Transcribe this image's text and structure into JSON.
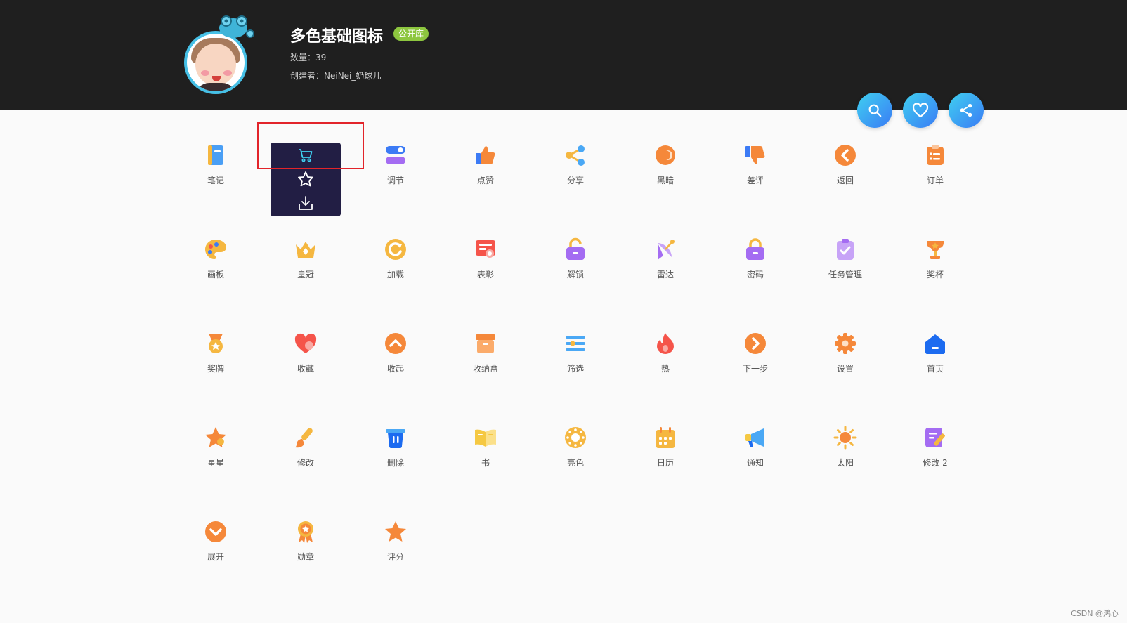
{
  "header": {
    "title": "多色基础图标",
    "badge": "公开库",
    "count_text": "数量：39",
    "creator_text": "创建者：NeiNei_奶球儿",
    "actions": [
      "search-icon",
      "heart-icon",
      "share-icon"
    ]
  },
  "hover_card": {
    "actions": [
      "cart-icon",
      "star-outline-icon",
      "download-icon"
    ]
  },
  "icons": [
    {
      "label": "笔记",
      "icon": "notebook-icon"
    },
    {
      "label": "",
      "icon": "cart-icon"
    },
    {
      "label": "调节",
      "icon": "toggle-icon"
    },
    {
      "label": "点赞",
      "icon": "thumbs-up-icon"
    },
    {
      "label": "分享",
      "icon": "share-nodes-icon"
    },
    {
      "label": "黑暗",
      "icon": "moon-icon"
    },
    {
      "label": "差评",
      "icon": "thumbs-down-icon"
    },
    {
      "label": "返回",
      "icon": "back-icon"
    },
    {
      "label": "订单",
      "icon": "order-icon"
    },
    {
      "label": "画板",
      "icon": "palette-icon"
    },
    {
      "label": "皇冠",
      "icon": "crown-icon"
    },
    {
      "label": "加载",
      "icon": "loading-icon"
    },
    {
      "label": "表彰",
      "icon": "certificate-icon"
    },
    {
      "label": "解锁",
      "icon": "unlock-icon"
    },
    {
      "label": "雷达",
      "icon": "radar-icon"
    },
    {
      "label": "密码",
      "icon": "lock-icon"
    },
    {
      "label": "任务管理",
      "icon": "task-icon"
    },
    {
      "label": "奖杯",
      "icon": "trophy-icon"
    },
    {
      "label": "奖牌",
      "icon": "medal-icon"
    },
    {
      "label": "收藏",
      "icon": "heart-icon"
    },
    {
      "label": "收起",
      "icon": "collapse-icon"
    },
    {
      "label": "收纳盒",
      "icon": "box-icon"
    },
    {
      "label": "筛选",
      "icon": "filter-icon"
    },
    {
      "label": "热",
      "icon": "fire-icon"
    },
    {
      "label": "下一步",
      "icon": "next-icon"
    },
    {
      "label": "设置",
      "icon": "gear-icon"
    },
    {
      "label": "首页",
      "icon": "home-icon"
    },
    {
      "label": "星星",
      "icon": "star-icon"
    },
    {
      "label": "修改",
      "icon": "brush-icon"
    },
    {
      "label": "删除",
      "icon": "trash-icon"
    },
    {
      "label": "书",
      "icon": "book-icon"
    },
    {
      "label": "亮色",
      "icon": "sun-ring-icon"
    },
    {
      "label": "日历",
      "icon": "calendar-icon"
    },
    {
      "label": "通知",
      "icon": "megaphone-icon"
    },
    {
      "label": "太阳",
      "icon": "sun-icon"
    },
    {
      "label": "修改 2",
      "icon": "edit-icon"
    },
    {
      "label": "展开",
      "icon": "expand-icon"
    },
    {
      "label": "勋章",
      "icon": "badge-icon"
    },
    {
      "label": "评分",
      "icon": "rating-icon"
    }
  ],
  "colors": {
    "header_bg": "#1f1f1f",
    "badge": "#8dc63f",
    "accent_gradient_start": "#3fd0f0",
    "accent_gradient_end": "#3a7bf5",
    "hover_card": "#221e44",
    "highlight": "#e2242a"
  },
  "watermark": "CSDN @鸿心"
}
